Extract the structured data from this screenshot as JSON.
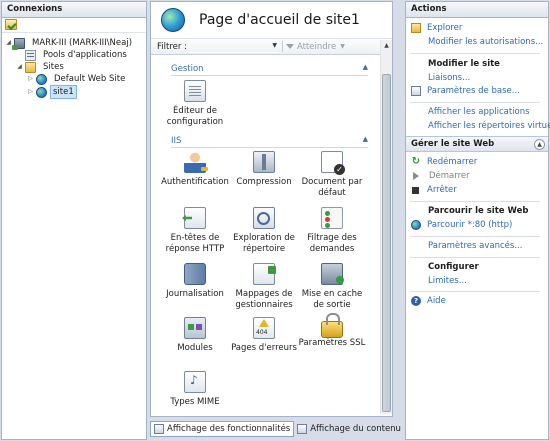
{
  "connections": {
    "title": "Connexions",
    "tree": [
      {
        "label": "MARK-III (MARK-III\\Neaj)",
        "expander": "◢"
      },
      {
        "label": "Pools d'applications",
        "expander": ""
      },
      {
        "label": "Sites",
        "expander": "◢"
      },
      {
        "label": "Default Web Site",
        "expander": "▷"
      },
      {
        "label": "site1",
        "expander": "▷"
      }
    ]
  },
  "center": {
    "title": "Page d'accueil de site1",
    "filter_label": "Filtrer :",
    "filter_value": "",
    "atteindre": "Atteindre",
    "groups": [
      {
        "name": "Gestion"
      },
      {
        "name": "IIS"
      }
    ],
    "features": [
      {
        "label": "Éditeur de configuration",
        "icon": "config-editor"
      },
      {
        "label": "Authentification",
        "icon": "authentication"
      },
      {
        "label": "Compression",
        "icon": "compression"
      },
      {
        "label": "Document par défaut",
        "icon": "default-document"
      },
      {
        "label": "En-têtes de réponse HTTP",
        "icon": "http-headers"
      },
      {
        "label": "Exploration de répertoire",
        "icon": "directory-browsing"
      },
      {
        "label": "Filtrage des demandes",
        "icon": "request-filtering"
      },
      {
        "label": "Journalisation",
        "icon": "logging"
      },
      {
        "label": "Mappages de gestionnaires",
        "icon": "handler-mappings"
      },
      {
        "label": "Mise en cache de sortie",
        "icon": "output-caching"
      },
      {
        "label": "Modules",
        "icon": "modules"
      },
      {
        "label": "Pages d'erreurs",
        "icon": "error-pages"
      },
      {
        "label": "Paramètres SSL",
        "icon": "ssl-settings"
      },
      {
        "label": "Types MIME",
        "icon": "mime-types"
      }
    ],
    "tabs": [
      "Affichage des fonctionnalités",
      "Affichage du contenu"
    ]
  },
  "actions": {
    "title": "Actions",
    "explorer": "Explorer",
    "modify_permissions": "Modifier les autorisations...",
    "edit_site_head": "Modifier le site",
    "bindings": "Liaisons...",
    "basic_settings": "Paramètres de base...",
    "view_apps": "Afficher les applications",
    "view_vdirs": "Afficher les répertoires virtuels",
    "manage_site": "Gérer le site Web",
    "restart": "Redémarrer",
    "start": "Démarrer",
    "stop": "Arrêter",
    "browse_head": "Parcourir le site Web",
    "browse_link": "Parcourir *:80 (http)",
    "advanced": "Paramètres avancés...",
    "configure_head": "Configurer",
    "limits": "Limites...",
    "help": "Aide"
  }
}
